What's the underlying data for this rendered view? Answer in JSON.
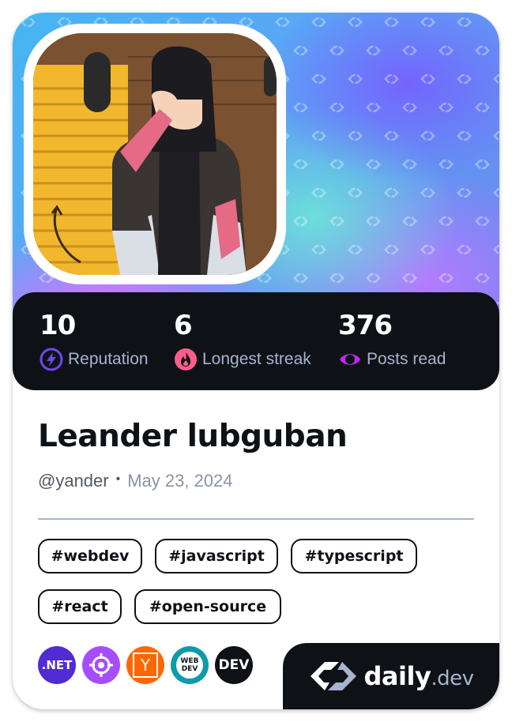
{
  "profile": {
    "name": "Leander lubguban",
    "handle": "@yander",
    "separator": "•",
    "joined": "May 23, 2024"
  },
  "stats": [
    {
      "value": "10",
      "label": "Reputation",
      "icon": "lightning-icon",
      "color": "#7147ed"
    },
    {
      "value": "6",
      "label": "Longest streak",
      "icon": "flame-icon",
      "color": "#ff5c8a"
    },
    {
      "value": "376",
      "label": "Posts read",
      "icon": "eye-icon",
      "color": "#c029f0"
    }
  ],
  "tags": [
    "#webdev",
    "#javascript",
    "#typescript",
    "#react",
    "#open-source"
  ],
  "sources": [
    {
      "label": ".NET",
      "icon": "dotnet-logo",
      "color": "#512bd4"
    },
    {
      "label": "",
      "icon": "crosshair-logo",
      "color": "#a64dff"
    },
    {
      "label": "Y",
      "icon": "ycombinator-logo",
      "color": "#ff6600"
    },
    {
      "label": "WEB DEV",
      "icon": "webdev-logo",
      "color": "#0e9ba8"
    },
    {
      "label": "DEV",
      "icon": "dev-logo",
      "color": "#0e1217"
    }
  ],
  "brand": {
    "name": "daily",
    "suffix": ".dev",
    "icon": "daily-dev-logo-icon"
  },
  "colors": {
    "dark": "#0e1217",
    "muted": "#a8b3cf",
    "text": "#525866"
  }
}
